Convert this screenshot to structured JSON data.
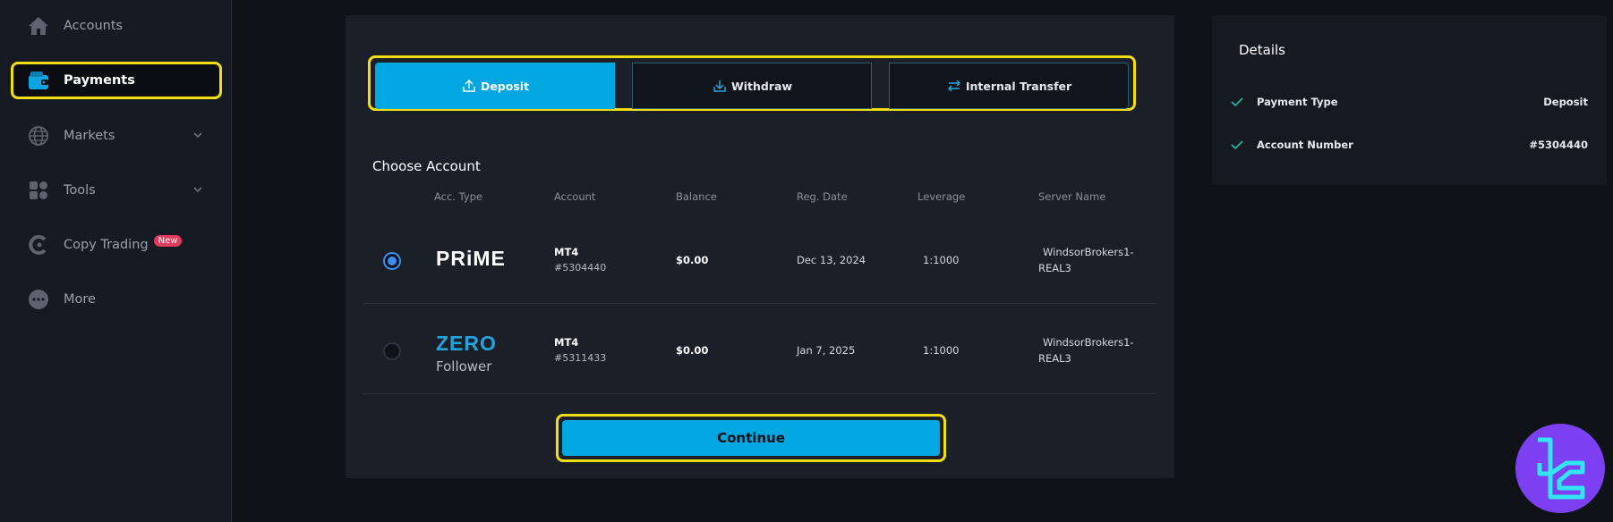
{
  "sidebar": {
    "items": [
      {
        "label": "Accounts"
      },
      {
        "label": "Payments"
      },
      {
        "label": "Markets"
      },
      {
        "label": "Tools"
      },
      {
        "label": "Copy Trading",
        "badge": "New"
      },
      {
        "label": "More"
      }
    ]
  },
  "tabs": [
    {
      "label": "Deposit"
    },
    {
      "label": "Withdraw"
    },
    {
      "label": "Internal Transfer"
    }
  ],
  "choose_account": {
    "title": "Choose Account",
    "columns": [
      "Acc. Type",
      "Account",
      "Balance",
      "Reg. Date",
      "Leverage",
      "Server Name"
    ],
    "rows": [
      {
        "acc_type": "PRiME",
        "acc_type_sub": "",
        "platform": "MT4",
        "account": "#5304440",
        "balance": "$0.00",
        "reg_date": "Dec 13, 2024",
        "leverage": "1:1000",
        "server_line1": "WindsorBrokers1-",
        "server_line2": "REAL3",
        "selected": true
      },
      {
        "acc_type": "ZERO",
        "acc_type_sub": "Follower",
        "platform": "MT4",
        "account": "#5311433",
        "balance": "$0.00",
        "reg_date": "Jan 7, 2025",
        "leverage": "1:1000",
        "server_line1": "WindsorBrokers1-",
        "server_line2": "REAL3",
        "selected": false
      }
    ]
  },
  "continue_label": "Continue",
  "details": {
    "title": "Details",
    "rows": [
      {
        "key": "Payment Type",
        "value": "Deposit"
      },
      {
        "key": "Account Number",
        "value": "#5304440"
      }
    ]
  },
  "colors": {
    "accent": "#00a7e1",
    "highlight": "#f1de16",
    "badge": "#e43a5d",
    "watermark": "#7c3ff2"
  }
}
